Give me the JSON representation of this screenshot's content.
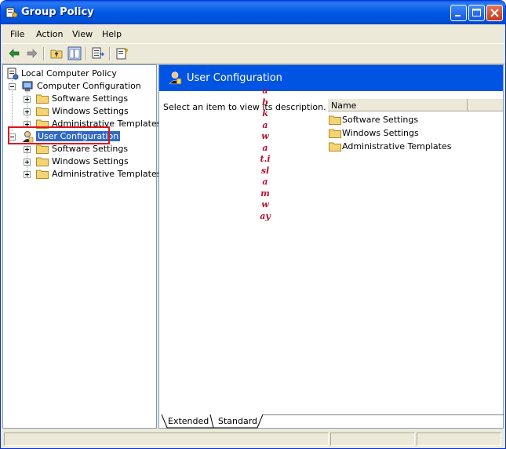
{
  "window": {
    "title": "Group Policy",
    "title_icon": "group-policy-icon"
  },
  "menu": {
    "items": [
      "File",
      "Action",
      "View",
      "Help"
    ]
  },
  "toolbar": {
    "icons": [
      "back-arrow-icon",
      "forward-arrow-icon",
      "up-folder-icon",
      "show-hide-tree-icon",
      "export-list-icon",
      "help-icon"
    ]
  },
  "tree": {
    "root": "Local Computer Policy",
    "computer_config": "Computer Configuration",
    "computer_children": [
      "Software Settings",
      "Windows Settings",
      "Administrative Templates"
    ],
    "user_config": "User Configuration",
    "user_children": [
      "Software Settings",
      "Windows Settings",
      "Administrative Templates"
    ]
  },
  "right_pane": {
    "header_title": "User Configuration",
    "description": "Select an item to view its description.",
    "column_name": "Name",
    "items": [
      "Software Settings",
      "Windows Settings",
      "Administrative Templates"
    ]
  },
  "watermark": {
    "text": "abkawat.islamway"
  },
  "tabs": {
    "extended": "Extended",
    "standard": "Standard"
  },
  "colors": {
    "title_bar": "#0054E3",
    "selection": "#316AC5",
    "highlight_box": "#E0141E",
    "watermark": "#B5122E"
  }
}
